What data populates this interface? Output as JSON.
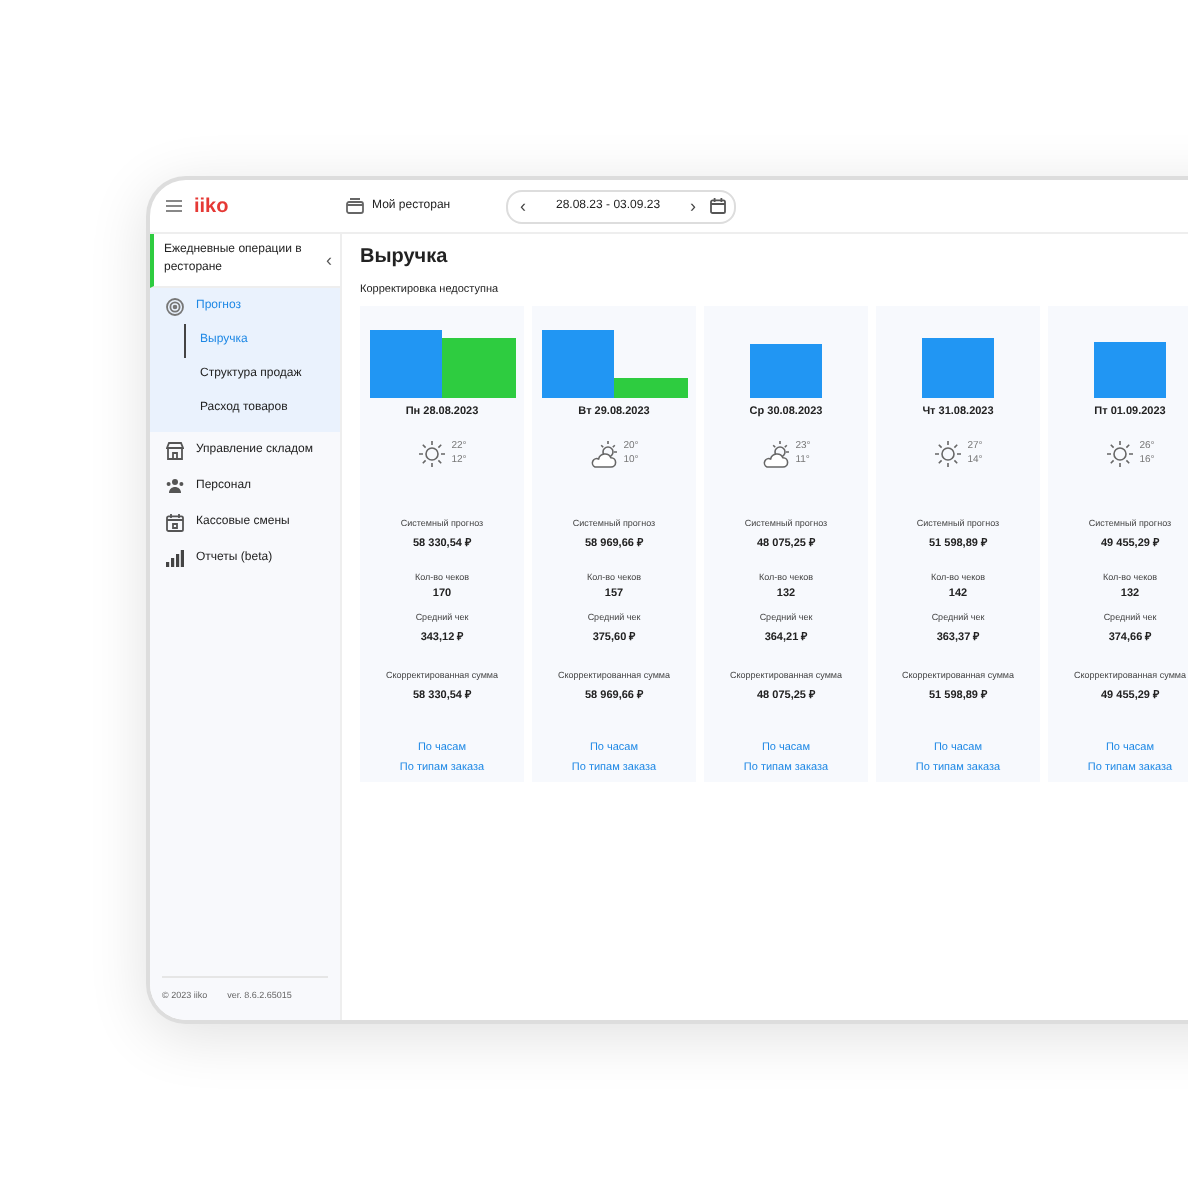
{
  "topbar": {
    "logo": "iiko",
    "restaurant": "Мой ресторан",
    "period": "28.08.23 - 03.09.23",
    "prev": "‹",
    "next": "›"
  },
  "sidebar": {
    "header": "Ежедневные операции в ресторане",
    "collapse": "‹",
    "items": [
      {
        "label": "Прогноз",
        "expanded": true,
        "selected": false,
        "children": [
          {
            "label": "Выручка",
            "selected": true
          },
          {
            "label": "Структура продаж",
            "selected": false
          },
          {
            "label": "Расход товаров",
            "selected": false
          }
        ]
      },
      {
        "label": "Управление складом",
        "expanded": false,
        "selected": false
      },
      {
        "label": "Персонал",
        "expanded": false,
        "selected": false
      },
      {
        "label": "Кассовые смены",
        "expanded": false,
        "selected": false
      },
      {
        "label": "Отчеты (beta)",
        "expanded": false,
        "selected": false
      }
    ],
    "copyright": "© 2023 iiko",
    "version": "ver. 8.6.2.65015"
  },
  "page": {
    "title": "Выручка",
    "note": "Корректировка недоступна",
    "days": [
      {
        "date": "Пн 28.08.2023",
        "kind": "sun",
        "high": "22°",
        "low": "12°",
        "forecast_label": "Системный прогноз",
        "forecast": "58 330,54 ₽",
        "checks_label": "Кол-во чеков",
        "checks": "170",
        "avg_label": "Средний чек",
        "avg": "343,12 ₽",
        "corrected_label": "Скорректированная сумма",
        "corrected": "58 330,54 ₽",
        "link_hours": "По часам",
        "link_types": "По типам заказа"
      },
      {
        "date": "Вт 29.08.2023",
        "kind": "cloud-sun",
        "high": "20°",
        "low": "10°",
        "forecast_label": "Системный прогноз",
        "forecast": "58 969,66 ₽",
        "checks_label": "Кол-во чеков",
        "checks": "157",
        "avg_label": "Средний чек",
        "avg": "375,60 ₽",
        "corrected_label": "Скорректированная сумма",
        "corrected": "58 969,66 ₽",
        "link_hours": "По часам",
        "link_types": "По типам заказа"
      },
      {
        "date": "Ср 30.08.2023",
        "kind": "cloud-sun",
        "high": "23°",
        "low": "11°",
        "forecast_label": "Системный прогноз",
        "forecast": "48 075,25 ₽",
        "checks_label": "Кол-во чеков",
        "checks": "132",
        "avg_label": "Средний чек",
        "avg": "364,21 ₽",
        "corrected_label": "Скорректированная сумма",
        "corrected": "48 075,25 ₽",
        "link_hours": "По часам",
        "link_types": "По типам заказа"
      },
      {
        "date": "Чт 31.08.2023",
        "kind": "sun",
        "high": "27°",
        "low": "14°",
        "forecast_label": "Системный прогноз",
        "forecast": "51 598,89 ₽",
        "checks_label": "Кол-во чеков",
        "checks": "142",
        "avg_label": "Средний чек",
        "avg": "363,37 ₽",
        "corrected_label": "Скорректированная сумма",
        "corrected": "51 598,89 ₽",
        "link_hours": "По часам",
        "link_types": "По типам заказа"
      },
      {
        "date": "Пт 01.09.2023",
        "kind": "sun",
        "high": "26°",
        "low": "16°",
        "forecast_label": "Системный прогноз",
        "forecast": "49 455,29 ₽",
        "checks_label": "Кол-во чеков",
        "checks": "132",
        "avg_label": "Средний чек",
        "avg": "374,66 ₽",
        "corrected_label": "Скорректированная сумма",
        "corrected": "49 455,29 ₽",
        "link_hours": "По часам",
        "link_types": "По типам заказа"
      }
    ]
  }
}
